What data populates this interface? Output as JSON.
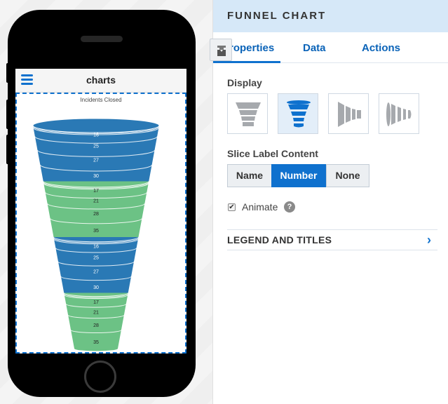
{
  "phone": {
    "app_title": "charts",
    "menu_icon": "hamburger-icon"
  },
  "chart_data": {
    "type": "funnel",
    "title": "Incidents Closed",
    "label_mode": "Number",
    "colors": [
      "#2a79b5",
      "#6cc285"
    ],
    "series": [
      {
        "group": 1,
        "color_index": 0,
        "values": [
          2,
          2,
          16,
          25,
          27,
          30
        ]
      },
      {
        "group": 2,
        "color_index": 1,
        "values": [
          2,
          2,
          17,
          21,
          28,
          35
        ]
      },
      {
        "group": 3,
        "color_index": 0,
        "values": [
          2,
          2,
          16,
          25,
          27,
          30
        ]
      },
      {
        "group": 4,
        "color_index": 1,
        "values": [
          2,
          2,
          17,
          21,
          28,
          35
        ]
      }
    ],
    "labels_shown": [
      "16",
      "25",
      "27",
      "30",
      "17",
      "21",
      "28",
      "35",
      "16",
      "25",
      "27",
      "30",
      "17",
      "21",
      "28",
      "35"
    ]
  },
  "panel": {
    "title": "FUNNEL CHART",
    "tabs": [
      {
        "label": "Properties",
        "active": true
      },
      {
        "label": "Data",
        "active": false
      },
      {
        "label": "Actions",
        "active": false
      }
    ],
    "tab_icon": "style-icon",
    "display": {
      "label": "Display",
      "options": [
        {
          "name": "funnel-flat",
          "selected": false
        },
        {
          "name": "funnel-3d",
          "selected": true
        },
        {
          "name": "horizontal-flat",
          "selected": false
        },
        {
          "name": "horizontal-3d",
          "selected": false
        }
      ]
    },
    "slice_label": {
      "label": "Slice Label Content",
      "options": [
        "Name",
        "Number",
        "None"
      ],
      "selected": "Number"
    },
    "animate": {
      "label": "Animate",
      "checked": true,
      "help": "?"
    },
    "legend_section": {
      "label": "LEGEND AND TITLES"
    }
  }
}
